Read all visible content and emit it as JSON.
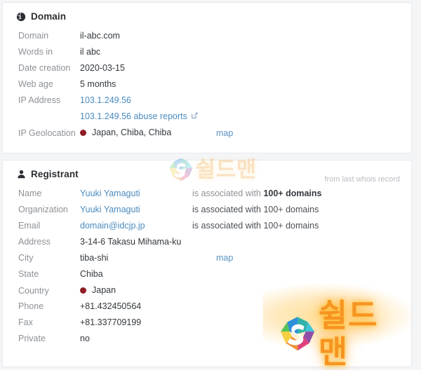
{
  "domain_card": {
    "icon": "globe-icon",
    "title": "Domain",
    "rows": [
      {
        "label": "Domain",
        "value": "il-abc.com",
        "type": "text"
      },
      {
        "label": "Words in",
        "value": "il abc",
        "type": "text"
      },
      {
        "label": "Date creation",
        "value": "2020-03-15",
        "type": "text"
      },
      {
        "label": "Web age",
        "value": "5 months",
        "type": "text"
      },
      {
        "label": "IP Address",
        "value": "103.1.249.56",
        "type": "link"
      },
      {
        "label": "",
        "value": "103.1.249.56 abuse reports",
        "type": "link-external",
        "icon": "external-link-icon"
      },
      {
        "label": "IP Geolocation",
        "value": "Japan, Chiba, Chiba",
        "type": "flag",
        "flag_color": "#8f1d27",
        "map": "map"
      }
    ]
  },
  "registrant_card": {
    "icon": "user-icon",
    "title": "Registrant",
    "note": "from last whois record",
    "rows": [
      {
        "label": "Name",
        "value": "Yuuki Yamaguti",
        "type": "link",
        "extra_prefix": "is associated with ",
        "extra_bold": "100+ domains"
      },
      {
        "label": "Organization",
        "value": "Yuuki Yamaguti",
        "type": "link",
        "extra_prefix": "is associated with ",
        "extra_bold": "100+ domains"
      },
      {
        "label": "Email",
        "value": "domain@idcjp.jp",
        "type": "link",
        "extra_prefix": "is associated with ",
        "extra_bold": "100+ domains"
      },
      {
        "label": "Address",
        "value": "3-14-6 Takasu Mihama-ku",
        "type": "text"
      },
      {
        "label": "City",
        "value": "tiba-shi",
        "type": "text",
        "map": "map"
      },
      {
        "label": "State",
        "value": "Chiba",
        "type": "text"
      },
      {
        "label": "Country",
        "value": "Japan",
        "type": "flag",
        "flag_color": "#8f1d27"
      },
      {
        "label": "Phone",
        "value": "+81.432450564",
        "type": "text"
      },
      {
        "label": "Fax",
        "value": "+81.337709199",
        "type": "text"
      },
      {
        "label": "Private",
        "value": "no",
        "type": "text"
      }
    ]
  },
  "watermarks": [
    {
      "name": "shieldman-watermark-top",
      "text": "쉴드맨",
      "logo": "shieldman-s-logo",
      "color": "#f0a23a"
    },
    {
      "name": "shieldman-watermark-bottom",
      "text": "쉴드맨",
      "logo": "shieldman-s-logo",
      "color": "#f79421"
    }
  ],
  "colors": {
    "link": "#4b8bbf",
    "label": "#8d9196",
    "value": "#33383d",
    "card_bg": "#ffffff",
    "page_bg": "#f4f5f7",
    "flag_dot": "#8f1d27"
  }
}
